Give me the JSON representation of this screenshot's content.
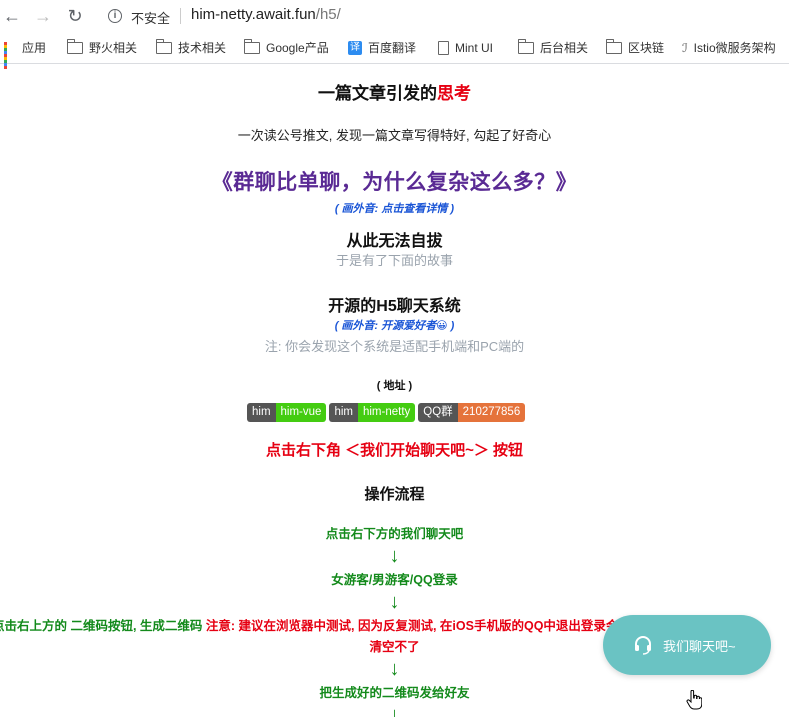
{
  "browser": {
    "security_label": "不安全",
    "url_host": "him-netty.await.fun",
    "url_path": "/h5/"
  },
  "bookmarks": [
    {
      "label": "应用",
      "icon": "apps-grid-icon"
    },
    {
      "label": "野火相关",
      "icon": "folder-icon"
    },
    {
      "label": "技术相关",
      "icon": "folder-icon"
    },
    {
      "label": "Google产品",
      "icon": "folder-icon"
    },
    {
      "label": "百度翻译",
      "icon": "translate-icon"
    },
    {
      "label": "Mint UI",
      "icon": "document-icon"
    },
    {
      "label": "后台相关",
      "icon": "folder-icon"
    },
    {
      "label": "区块链",
      "icon": "folder-icon"
    },
    {
      "label": "Istio微服务架构",
      "icon": "istio-icon"
    }
  ],
  "page": {
    "title_prefix": "一篇文章引发的",
    "title_highlight": "思考",
    "intro": "一次读公号推文, 发现一篇文章写得特好, 勾起了好奇心",
    "article_title": "《群聊比单聊，为什么复杂这么多？》",
    "aside_details": "( 画外音: 点击查看详情 )",
    "hooked": "从此无法自拔",
    "story": "于是有了下面的故事",
    "system_title": "开源的H5聊天系统",
    "aside_fans": "( 画外音: 开源爱好者😀 )",
    "note": "注: 你会发现这个系统是适配手机端和PC端的",
    "address_label": "( 地址 )",
    "badges": [
      {
        "left": "him",
        "right": "him-vue",
        "color": "green"
      },
      {
        "left": "him",
        "right": "him-netty",
        "color": "green"
      },
      {
        "left": "QQ群",
        "right": "210277856",
        "color": "orange"
      }
    ],
    "cta": "点击右下角 ＜我们开始聊天吧~＞ 按钮",
    "flow_title": "操作流程",
    "steps": [
      "点击右下方的我们聊天吧",
      "女游客/男游客/QQ登录"
    ],
    "step3_green": "点击右上方的 二维码按钮, 生成二维码 ",
    "step3_red": "注意: 建议在浏览器中测试, 因为反复测试, 在iOS手机版的QQ中退出登录会失败, 因为Cookie",
    "step3_red_cont": "清空不了",
    "step4": "把生成好的二维码发给好友",
    "arrow": "↓"
  },
  "chat_button": {
    "label": "我们聊天吧~",
    "background": "#6ac3c3"
  },
  "colors": {
    "highlight_red": "#e60012",
    "article_purple": "#5a2a94",
    "aside_blue": "#1a55d6",
    "step_green": "#138a1b"
  }
}
